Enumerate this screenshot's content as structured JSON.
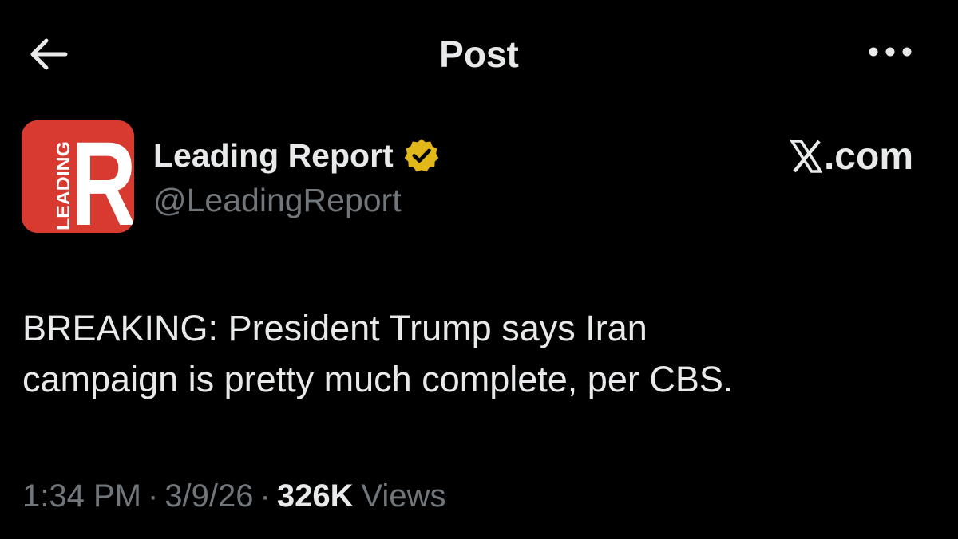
{
  "header": {
    "title": "Post",
    "back_icon": "arrow-left-icon",
    "more_icon": "more-horizontal-icon"
  },
  "author": {
    "name": "Leading Report",
    "handle": "@LeadingReport",
    "verified": true,
    "verified_icon": "verified-badge-icon",
    "avatar": {
      "icon": "leading-report-logo",
      "letter": "R",
      "vertical_text": "LEADING",
      "bg_color": "#d93a2f"
    }
  },
  "site": {
    "logo_icon": "x-logo-icon",
    "domain": ".com"
  },
  "post": {
    "text": "BREAKING: President Trump says Iran\ncampaign is pretty much complete, per CBS."
  },
  "meta": {
    "time": "1:34 PM",
    "separator": "·",
    "date": "3/9/26",
    "views_count": "326K",
    "views_label": "Views"
  },
  "colors": {
    "background": "#000000",
    "text_primary": "#e7e9ea",
    "text_secondary": "#71767b",
    "verified_gold": "#e2b719"
  }
}
